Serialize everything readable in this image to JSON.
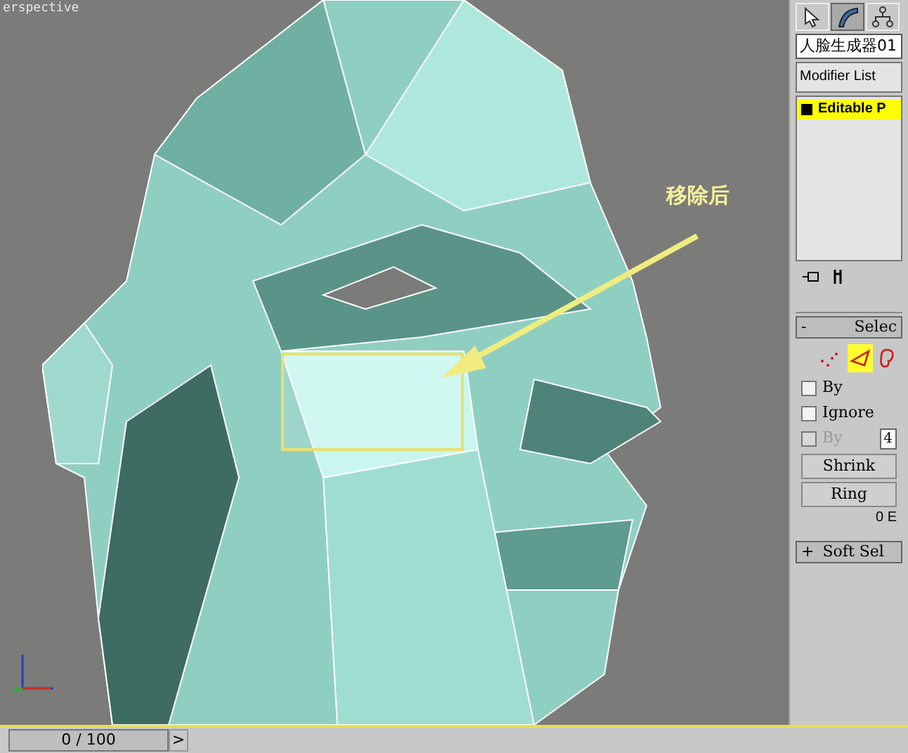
{
  "viewport": {
    "label": "erspective",
    "annotation": "移除后",
    "highlight": true
  },
  "panel": {
    "tabs": [
      {
        "kind": "create",
        "selected": false
      },
      {
        "kind": "modify",
        "selected": true
      },
      {
        "kind": "hierarchy",
        "selected": false
      }
    ],
    "object_name": "人脸生成器01",
    "modifier_list": "Modifier List",
    "stack": [
      {
        "label": "Editable P",
        "selected": true
      }
    ],
    "selection": {
      "sign": "-",
      "title": "Selec",
      "expanded": true,
      "levels": [
        {
          "kind": "vertex",
          "selected": false
        },
        {
          "kind": "edge",
          "selected": true
        },
        {
          "kind": "border",
          "selected": false
        }
      ],
      "checkboxes": [
        {
          "label": "By",
          "checked": false,
          "disabled": false
        },
        {
          "label": "Ignore",
          "checked": false,
          "disabled": false
        },
        {
          "label": "By",
          "checked": false,
          "disabled": true,
          "value": "4"
        }
      ],
      "buttons": [
        "Shrink",
        "Ring"
      ],
      "status": "0 E"
    },
    "soft_selection": {
      "sign": "+",
      "title": "Soft Sel"
    }
  },
  "timeline": {
    "frame": "0 / 100",
    "level": 0,
    "next": ">"
  }
}
